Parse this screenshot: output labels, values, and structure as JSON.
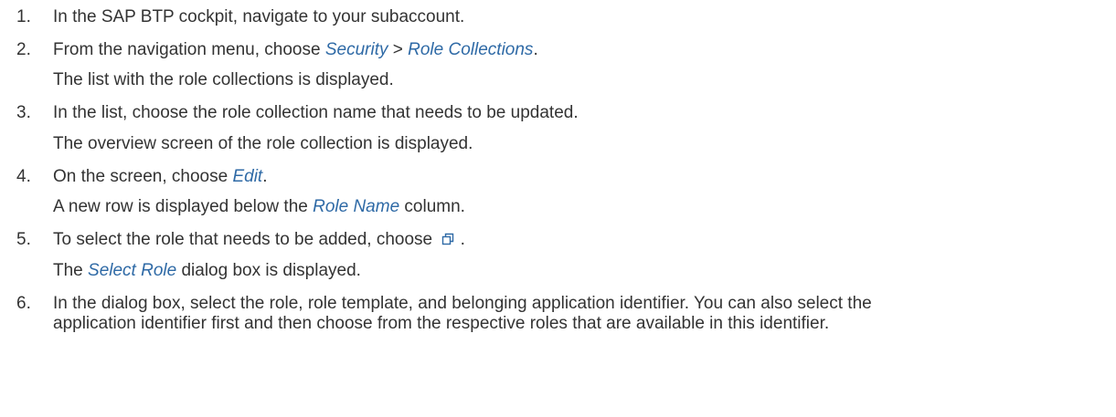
{
  "steps": [
    {
      "number": "1.",
      "text": "In the SAP BTP cockpit, navigate to your subaccount."
    },
    {
      "number": "2.",
      "pre": "From the navigation menu, choose ",
      "link1": "Security",
      "sep": " > ",
      "link2": "Role Collections",
      "post": ".",
      "result": "The list with the role collections is displayed."
    },
    {
      "number": "3.",
      "text": "In the list, choose the role collection name that needs to be updated.",
      "result": "The overview screen of the role collection is displayed."
    },
    {
      "number": "4.",
      "pre": "On the screen, choose ",
      "link": "Edit",
      "post": ".",
      "result_pre": "A new row is displayed below the ",
      "result_link": "Role Name",
      "result_post": " column."
    },
    {
      "number": "5.",
      "pre": "To select the role that needs to be added, choose ",
      "icon": "value-help-icon",
      "post": " .",
      "result_pre": "The ",
      "result_link": "Select Role",
      "result_post": " dialog box is displayed."
    },
    {
      "number": "6.",
      "line1": "In the dialog box, select the role, role template, and belonging application identifier. You can also select the",
      "line2": "application identifier first and then choose from the respective roles that are available in this identifier."
    }
  ],
  "colors": {
    "text": "#333333",
    "link": "#2f6aa6",
    "icon": "#2f6aa6"
  }
}
